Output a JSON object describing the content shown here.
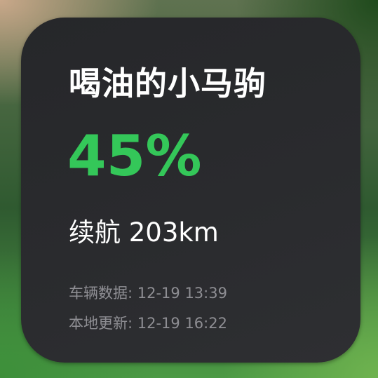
{
  "widget": {
    "title": "喝油的小马驹",
    "battery_percent_text": "45%",
    "battery_percent": 45,
    "range_label": "续航 203km",
    "vehicle_data_label": "车辆数据: 12-19 13:39",
    "local_update_label": "本地更新: 12-19 16:22"
  },
  "colors": {
    "accent": "#34c759",
    "widget_bg": "#2a2b2e",
    "text_primary": "#ffffff",
    "text_secondary": "#8e8e93"
  }
}
